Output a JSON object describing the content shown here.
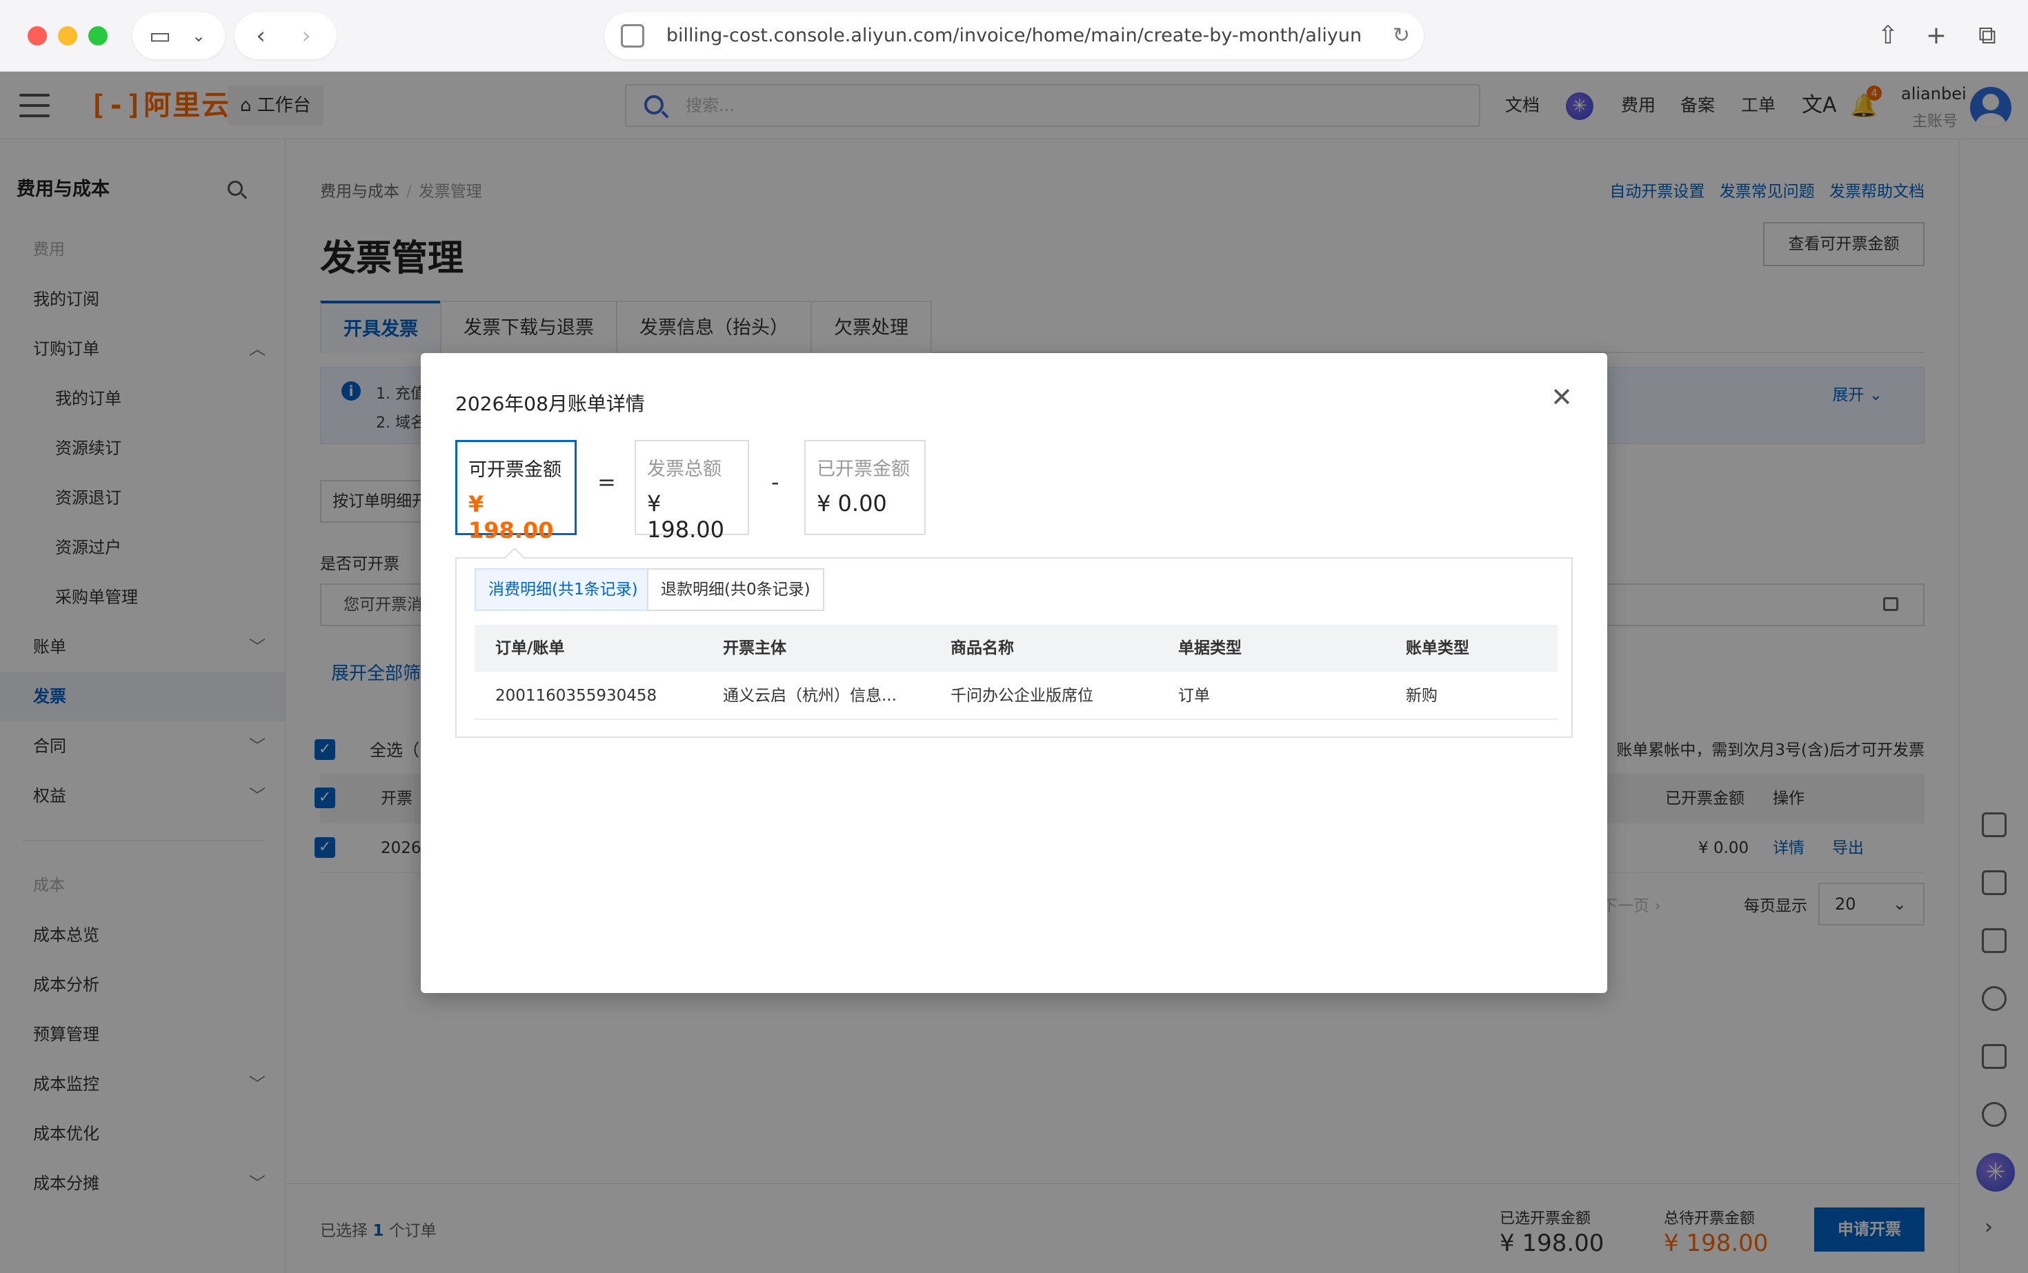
{
  "browser": {
    "url": "billing-cost.console.aliyun.com/invoice/home/main/create-by-month/aliyun"
  },
  "topbar": {
    "logo": "阿里云",
    "workbench": "工作台",
    "search_placeholder": "搜索...",
    "links": [
      "文档",
      "费用",
      "备案",
      "工单"
    ],
    "notification_count": "4",
    "username": "alianbei",
    "user_role": "主账号"
  },
  "sidebar": {
    "title": "费用与成本",
    "items": [
      {
        "label": "费用",
        "type": "group"
      },
      {
        "label": "我的订阅"
      },
      {
        "label": "订购订单",
        "expanded": true
      },
      {
        "label": "我的订单",
        "type": "sub"
      },
      {
        "label": "资源续订",
        "type": "sub"
      },
      {
        "label": "资源退订",
        "type": "sub"
      },
      {
        "label": "资源过户",
        "type": "sub"
      },
      {
        "label": "采购单管理",
        "type": "sub"
      },
      {
        "label": "账单"
      },
      {
        "label": "发票",
        "active": true
      },
      {
        "label": "合同"
      },
      {
        "label": "权益"
      },
      {
        "label": "成本",
        "type": "group"
      },
      {
        "label": "成本总览"
      },
      {
        "label": "成本分析"
      },
      {
        "label": "预算管理"
      },
      {
        "label": "成本监控"
      },
      {
        "label": "成本优化"
      },
      {
        "label": "成本分摊"
      }
    ]
  },
  "main": {
    "breadcrumb": [
      "费用与成本",
      "发票管理"
    ],
    "help_links": [
      "自动开票设置",
      "发票常见问题",
      "发票帮助文档"
    ],
    "title": "发票管理",
    "view_amount_button": "查看可开票金额",
    "tabs": [
      "开具发票",
      "发票下载与退票",
      "发票信息（抬头）",
      "欠票处理"
    ],
    "notice": {
      "line1": "1. 充值",
      "line2": "2. 域名",
      "expand": "展开"
    },
    "filter_select": "按订单明细开",
    "invoiceable_label": "是否可开票",
    "date_placeholder": "您可开票消",
    "expand_all": "展开全部筛",
    "select_all": "全选（",
    "right_note": "账单累帐中，需到次月3号(含)后才可开发票",
    "table": {
      "col_first": "开票",
      "col_issued": "已开票金额",
      "col_action": "操作",
      "row_first": "2026",
      "row_issued": "¥ 0.00",
      "row_detail": "详情",
      "row_export": "导出"
    },
    "pager_next": "下一页",
    "per_page_label": "每页显示",
    "per_page_value": "20"
  },
  "bottom_bar": {
    "selected_prefix": "已选择",
    "selected_count": "1",
    "selected_suffix": "个订单",
    "selected_amount_label": "已选开票金额",
    "selected_amount": "¥ 198.00",
    "total_pending_label": "总待开票金额",
    "total_pending": "¥ 198.00",
    "apply_button": "申请开票"
  },
  "modal": {
    "title": "2026年08月账单详情",
    "cards": [
      {
        "label": "可开票金额",
        "value": "¥ 198.00"
      },
      {
        "label": "发票总额",
        "value": "¥ 198.00"
      },
      {
        "label": "已开票金额",
        "value": "¥ 0.00"
      }
    ],
    "op_equals": "=",
    "op_minus": "-",
    "segments": [
      "消费明细(共1条记录)",
      "退款明细(共0条记录)"
    ],
    "columns": [
      "订单/账单",
      "开票主体",
      "商品名称",
      "单据类型",
      "账单类型"
    ],
    "rows": [
      [
        "2001160355930458",
        "通义云启（杭州）信息...",
        "千问办公企业版席位",
        "订单",
        "新购"
      ]
    ]
  },
  "colors": {
    "primary": "#0064c8",
    "accent": "#ff6a00"
  }
}
